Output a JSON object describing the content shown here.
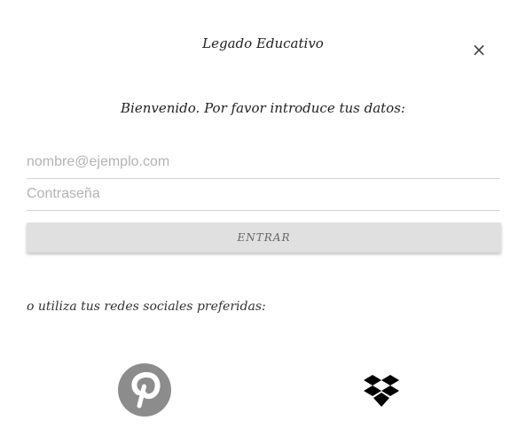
{
  "header": {
    "title": "Legado Educativo",
    "close_symbol": "×"
  },
  "login": {
    "welcome_text": "Bienvenido. Por favor introduce tus datos:",
    "email_placeholder": "nombre@ejemplo.com",
    "email_value": "",
    "password_placeholder": "Contraseña",
    "password_value": "",
    "submit_label": "ENTRAR"
  },
  "social": {
    "prompt": "o utiliza tus redes sociales preferidas:",
    "providers": [
      {
        "icon": "pinterest-icon",
        "color": "#8c8c8c"
      },
      {
        "icon": "dropbox-icon",
        "color": "#000000"
      }
    ]
  },
  "colors": {
    "button_background": "#e0e0e0",
    "field_underline": "#d6d6d6",
    "placeholder": "#b3b3b3"
  }
}
